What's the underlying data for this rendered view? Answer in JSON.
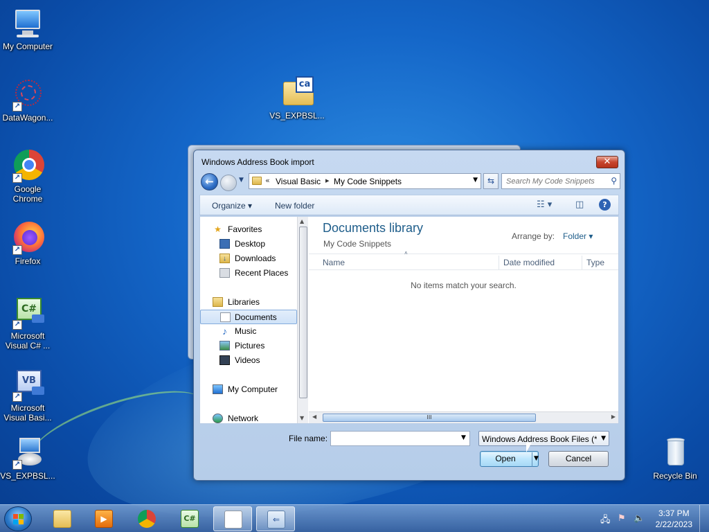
{
  "desktop": {
    "icons": [
      {
        "label": "My Computer"
      },
      {
        "label": "DataWagon..."
      },
      {
        "label": "Google Chrome"
      },
      {
        "label": "Firefox"
      },
      {
        "label": "Microsoft Visual C# ..."
      },
      {
        "label": "Microsoft Visual Basi..."
      },
      {
        "label": "VS_EXPBSL..."
      },
      {
        "label": "VS_EXPBSL..."
      },
      {
        "label": "Recycle Bin"
      }
    ],
    "ca_badge": "ca",
    "cs_badge": "C#",
    "vb_badge": "VB"
  },
  "dialog": {
    "title": "Windows Address Book import",
    "close_glyph": "✕",
    "address": {
      "chevrons": "«",
      "crumbs": [
        "Visual Basic",
        "My Code Snippets"
      ],
      "separator": "▸"
    },
    "search_placeholder": "Search My Code Snippets",
    "toolbar": {
      "organize": "Organize",
      "new_folder": "New folder"
    },
    "nav": {
      "favorites": "Favorites",
      "desktop": "Desktop",
      "downloads": "Downloads",
      "recent_places": "Recent Places",
      "libraries": "Libraries",
      "documents": "Documents",
      "music": "Music",
      "pictures": "Pictures",
      "videos": "Videos",
      "my_computer": "My Computer",
      "network": "Network"
    },
    "library": {
      "title": "Documents library",
      "subtitle": "My Code Snippets",
      "arrange_label": "Arrange by:",
      "arrange_value": "Folder"
    },
    "columns": {
      "name": "Name",
      "date_modified": "Date modified",
      "type": "Type"
    },
    "empty_message": "No items match your search.",
    "scroll_grip": "III",
    "file_name_label": "File name:",
    "file_name_value": "",
    "filter_value": "Windows Address Book Files (*.",
    "open_label": "Open",
    "cancel_label": "Cancel"
  },
  "taskbar": {
    "time": "3:37 PM",
    "date": "2/22/2023"
  }
}
